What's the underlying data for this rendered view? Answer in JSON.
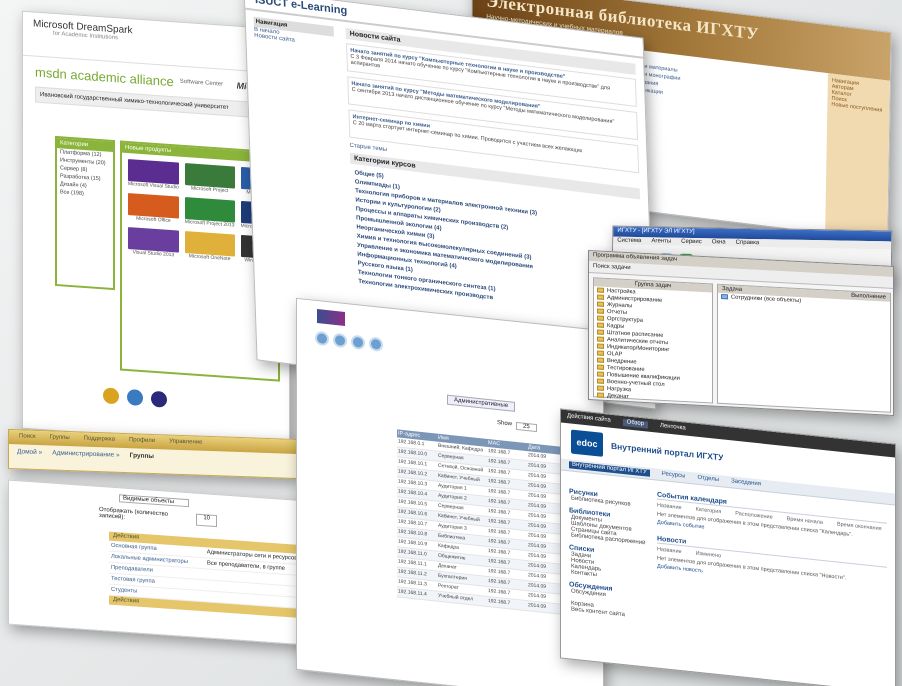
{
  "dreamspark": {
    "title": "Microsoft DreamSpark",
    "subtitle": "for Academic Institutions",
    "brand": "msdn academic alliance",
    "brand_sub": "Software Center",
    "ms": "Microsoft",
    "strip": "Ивановский государственный химико-технологический университет",
    "cats_title": "Категории",
    "cats": [
      "Платформа (12)",
      "Инструменты (20)",
      "Сервер (8)",
      "Разработка (15)",
      "Дизайн (4)",
      "Все (198)"
    ],
    "prods_title": "Новые продукты",
    "products": [
      "Microsoft Visual Studio",
      "Microsoft Project",
      "Microsoft Visio",
      "Microsoft Office",
      "Microsoft Project 2013",
      "Microsoft SQL 2012",
      "Visual Studio 2013",
      "Microsoft OneNote",
      "Windows Server"
    ]
  },
  "elearning": {
    "title": "ISUCT e-Learning",
    "nav_title": "Навигация",
    "nav_items": [
      "В начало",
      "Новости сайта"
    ],
    "news_title": "Новости сайта",
    "posts": [
      {
        "head": "Начато занятий по курсу \"Компьютерные технологии в науке и производстве\"",
        "body": "С 3 Февраля 2014 начато обучение по курсу \"Компьютерные технологии в науке и производстве\" для аспирантов"
      },
      {
        "head": "Начато занятий по курсу \"Методы математического моделирования\"",
        "body": "С сентября 2013 начато дистанционное обучение по курсу \"Методы математического моделирования\""
      },
      {
        "head": "Интернет-семинар по химии",
        "body": "С 20 марта стартует интернет-семинар по химии. Проводится с участием всех желающих"
      }
    ],
    "old_topics": "Старые темы",
    "cats_title": "Категории курсов",
    "categories": [
      "Общее (5)",
      "Олимпиады (1)",
      "Технология приборов и материалов электронной техники (3)",
      "Истории и культурологии (2)",
      "Процессы и аппараты химических производств (2)",
      "Промышленной экологии (4)",
      "Неорганической химии (3)",
      "Химия и технология высокомолекулярных соединений (3)",
      "Управление и экономика математического моделирования",
      "Информационных технологий (4)",
      "Русского языка (1)",
      "Технологии тонкого органического синтеза (1)",
      "Технологии электрохимических производств"
    ]
  },
  "library": {
    "title": "Электронная библиотека ИГХТУ",
    "subtitle": "Научно-методических и учебных материалов",
    "side_items": [
      "Навигация",
      "Авторам",
      "Каталог",
      "Поиск",
      "Новые поступления"
    ],
    "lines": [
      "Учебные пособия и материалы",
      "Научные издания и монографии",
      "Методические указания",
      "Электронные публикации"
    ]
  },
  "ics": {
    "title": "ИГХТУ - [ИГХТУ ЭЛ ИГХТУ]",
    "menu": [
      "Система",
      "Агенты",
      "Сервис",
      "Окна",
      "Справка"
    ]
  },
  "tasks": {
    "title": "Программа объявления задач",
    "search": "Поиск задачи",
    "tree_title": "Группа задач",
    "nodes": [
      "Настройка",
      "Администрирование",
      "Журналы",
      "Отчеты",
      "Оргструктура",
      "Кадры",
      "Штатное расписание",
      "Аналитические отчеты",
      "Индикатор/Мониторинг",
      "OLAP",
      "Внедрение",
      "Тестирование",
      "Повышение квалификации",
      "Военно-учетный стол",
      "Нагрузка",
      "Деканат",
      "Справочники",
      "Отчеты",
      "Настройки"
    ],
    "col_task": "Задача",
    "col_run": "Выполнение",
    "task_row": "Сотрудники (все объекты)"
  },
  "gold": {
    "tabs": [
      "Поиск",
      "Группы",
      "Поддержка",
      "Профили",
      "Управление"
    ],
    "crumbs": [
      "Домой »",
      "Администрирование »",
      "Группы"
    ]
  },
  "listwin": {
    "filter": "Видимые объекты",
    "show_count": "Отображать (количество записей):",
    "count_val": "10",
    "group_head": "Действия",
    "rows": [
      "Основная группа",
      "Локальные администраторы",
      "Преподаватели",
      "Тестовая группа",
      "Студенты"
    ],
    "descs": [
      "Администраторы сети и ресурсов",
      "Все преподаватели, в группе",
      "",
      "",
      ""
    ]
  },
  "dcs": {
    "tab": "Административные",
    "show": "Show",
    "show_val": "25",
    "headers": [
      "IP-адрес",
      "Имя",
      "MAC",
      "Дата"
    ],
    "rows": [
      [
        "192.168.0.1",
        "Внешний, Кафедра",
        "192.168.7",
        "2014.09"
      ],
      [
        "192.168.10.0",
        "Серверная",
        "192.168.7",
        "2014.09"
      ],
      [
        "192.168.10.1",
        "Сетевой, Основной",
        "192.168.7",
        "2014.09"
      ],
      [
        "192.168.10.2",
        "Кабинет, Учебный",
        "192.168.7",
        "2014.09"
      ],
      [
        "192.168.10.3",
        "Аудитория 1",
        "192.168.7",
        "2014.09"
      ],
      [
        "192.168.10.4",
        "Аудитория 2",
        "192.168.7",
        "2014.09"
      ],
      [
        "192.168.10.5",
        "Серверная",
        "192.168.7",
        "2014.09"
      ],
      [
        "192.168.10.6",
        "Кабинет, Учебный",
        "192.168.7",
        "2014.09"
      ],
      [
        "192.168.10.7",
        "Аудитория 3",
        "192.168.7",
        "2014.09"
      ],
      [
        "192.168.10.8",
        "Библиотека",
        "192.168.7",
        "2014.09"
      ],
      [
        "192.168.10.9",
        "Кафедра",
        "192.168.7",
        "2014.09"
      ],
      [
        "192.168.11.0",
        "Общежитие",
        "192.168.7",
        "2014.09"
      ],
      [
        "192.168.11.1",
        "Деканат",
        "192.168.7",
        "2014.09"
      ],
      [
        "192.168.11.2",
        "Бухгалтерия",
        "192.168.7",
        "2014.09"
      ],
      [
        "192.168.11.3",
        "Ректорат",
        "192.168.7",
        "2014.09"
      ],
      [
        "192.168.11.4",
        "Учебный отдел",
        "192.168.7",
        "2014.09"
      ]
    ]
  },
  "sp": {
    "actions": "Действия сайта",
    "tabs": [
      "Обзор",
      "Ленточка"
    ],
    "logo": "edoc",
    "site_title": "Внутренний портал ИГХТУ",
    "menu": [
      "Внутренний портал ИГХТУ",
      "Ресурсы",
      "Отделы",
      "Заседания"
    ],
    "left": [
      {
        "g": "Рисунки",
        "items": [
          "Библиотека рисунков"
        ]
      },
      {
        "g": "Библиотеки",
        "items": [
          "Документы",
          "Шаблоны документов",
          "Страницы сайта",
          "Библиотека распоряжений"
        ]
      },
      {
        "g": "Списки",
        "items": [
          "Задачи",
          "Новости",
          "Календарь",
          "Контакты"
        ]
      },
      {
        "g": "Обсуждения",
        "items": [
          "Обсуждения"
        ]
      },
      {
        "g": "",
        "items": [
          "Корзина",
          "Весь контент сайта"
        ]
      }
    ],
    "wp1": "События календаря",
    "wp1_cols": [
      "Название",
      "Категория",
      "Расположение",
      "Время начала",
      "Время окончания"
    ],
    "wp1_empty": "Нет элементов для отображения в этом представлении списка \"Календарь\".",
    "wp1_add": "Добавить событие",
    "wp2": "Новости",
    "wp2_cols": [
      "Название",
      "Изменено"
    ],
    "wp2_empty": "Нет элементов для отображения в этом представлении списка \"Новости\".",
    "wp2_add": "Добавить новость"
  }
}
